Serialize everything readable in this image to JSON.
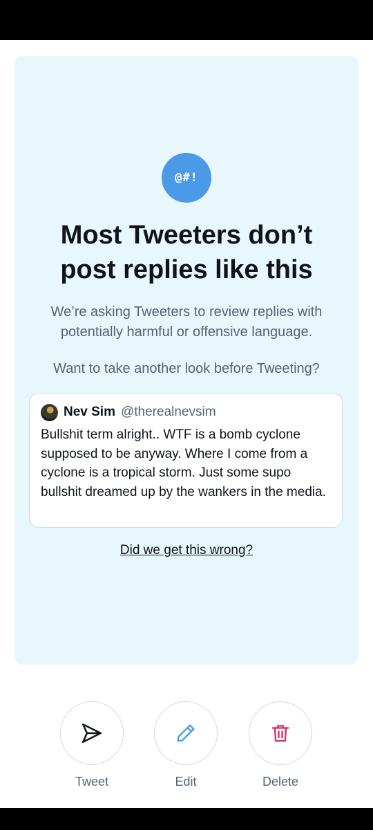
{
  "prompt": {
    "badge_text": "@#!",
    "headline_line1": "Most Tweeters don’t",
    "headline_line2": "post replies like this",
    "subtext_line1": "We’re asking Tweeters to review replies with",
    "subtext_line2": "potentially harmful or offensive language.",
    "question": "Want to take another look before Tweeting?",
    "wrong_link": "Did we get this wrong?"
  },
  "tweet": {
    "name": "Nev Sim",
    "handle": "@therealnevsim",
    "text": "Bullshit term alright.. WTF is a bomb cyclone supposed to be anyway. Where I come from a cyclone is a tropical storm. Just some supo bullshit dreamed up by the wankers in the media."
  },
  "actions": {
    "tweet_label": "Tweet",
    "edit_label": "Edit",
    "delete_label": "Delete",
    "tweet_icon": "send-icon",
    "edit_icon": "pencil-icon",
    "delete_icon": "trash-icon"
  },
  "colors": {
    "card_background": "#e8f7fc",
    "badge": "#4b9ae8",
    "edit_icon": "#4b9ae8",
    "delete_icon": "#e0245e",
    "text_primary": "#0f1419",
    "text_secondary": "#536471"
  }
}
